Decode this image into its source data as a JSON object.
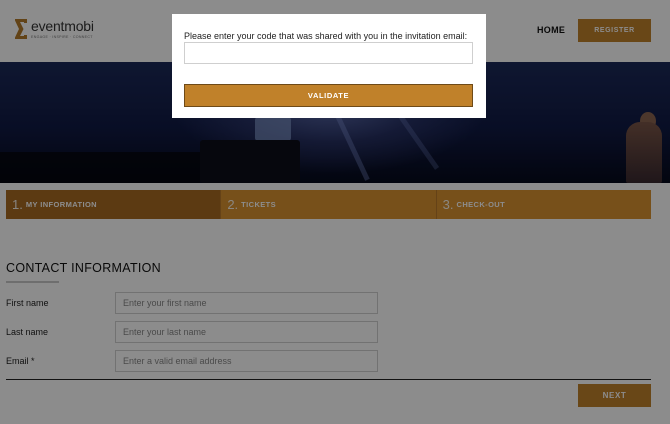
{
  "header": {
    "logo_name": "eventmobi",
    "logo_tagline": "ENGAGE · INSPIRE · CONNECT",
    "nav_home": "HOME",
    "register_label": "REGISTER"
  },
  "steps": [
    {
      "num": "1.",
      "label": "MY INFORMATION",
      "active": true
    },
    {
      "num": "2.",
      "label": "TICKETS",
      "active": false
    },
    {
      "num": "3.",
      "label": "CHECK-OUT",
      "active": false
    }
  ],
  "form": {
    "section_title": "CONTACT INFORMATION",
    "first_name": {
      "label": "First name",
      "placeholder": "Enter your first name",
      "value": ""
    },
    "last_name": {
      "label": "Last name",
      "placeholder": "Enter your last name",
      "value": ""
    },
    "email": {
      "label": "Email *",
      "placeholder": "Enter a valid email address",
      "value": ""
    },
    "next_label": "NEXT"
  },
  "modal": {
    "prompt": "Please enter your code that was shared with you in the invitation email:",
    "code_value": "",
    "validate_label": "VALIDATE"
  },
  "colors": {
    "accent": "#c0812a",
    "step_active": "#a86a22",
    "step_inactive": "#d99330"
  }
}
